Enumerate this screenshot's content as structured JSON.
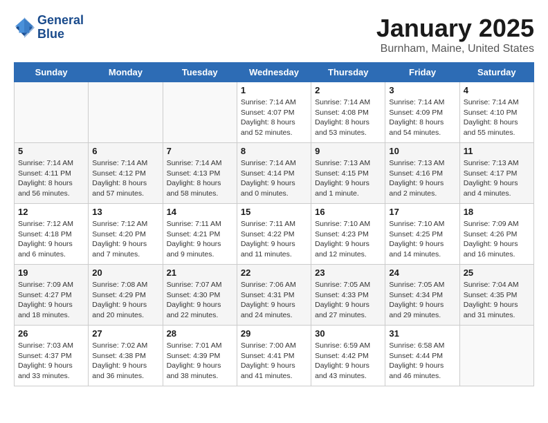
{
  "logo": {
    "line1": "General",
    "line2": "Blue"
  },
  "title": "January 2025",
  "location": "Burnham, Maine, United States",
  "days_of_week": [
    "Sunday",
    "Monday",
    "Tuesday",
    "Wednesday",
    "Thursday",
    "Friday",
    "Saturday"
  ],
  "weeks": [
    [
      {
        "day": "",
        "info": ""
      },
      {
        "day": "",
        "info": ""
      },
      {
        "day": "",
        "info": ""
      },
      {
        "day": "1",
        "info": "Sunrise: 7:14 AM\nSunset: 4:07 PM\nDaylight: 8 hours and 52 minutes."
      },
      {
        "day": "2",
        "info": "Sunrise: 7:14 AM\nSunset: 4:08 PM\nDaylight: 8 hours and 53 minutes."
      },
      {
        "day": "3",
        "info": "Sunrise: 7:14 AM\nSunset: 4:09 PM\nDaylight: 8 hours and 54 minutes."
      },
      {
        "day": "4",
        "info": "Sunrise: 7:14 AM\nSunset: 4:10 PM\nDaylight: 8 hours and 55 minutes."
      }
    ],
    [
      {
        "day": "5",
        "info": "Sunrise: 7:14 AM\nSunset: 4:11 PM\nDaylight: 8 hours and 56 minutes."
      },
      {
        "day": "6",
        "info": "Sunrise: 7:14 AM\nSunset: 4:12 PM\nDaylight: 8 hours and 57 minutes."
      },
      {
        "day": "7",
        "info": "Sunrise: 7:14 AM\nSunset: 4:13 PM\nDaylight: 8 hours and 58 minutes."
      },
      {
        "day": "8",
        "info": "Sunrise: 7:14 AM\nSunset: 4:14 PM\nDaylight: 9 hours and 0 minutes."
      },
      {
        "day": "9",
        "info": "Sunrise: 7:13 AM\nSunset: 4:15 PM\nDaylight: 9 hours and 1 minute."
      },
      {
        "day": "10",
        "info": "Sunrise: 7:13 AM\nSunset: 4:16 PM\nDaylight: 9 hours and 2 minutes."
      },
      {
        "day": "11",
        "info": "Sunrise: 7:13 AM\nSunset: 4:17 PM\nDaylight: 9 hours and 4 minutes."
      }
    ],
    [
      {
        "day": "12",
        "info": "Sunrise: 7:12 AM\nSunset: 4:18 PM\nDaylight: 9 hours and 6 minutes."
      },
      {
        "day": "13",
        "info": "Sunrise: 7:12 AM\nSunset: 4:20 PM\nDaylight: 9 hours and 7 minutes."
      },
      {
        "day": "14",
        "info": "Sunrise: 7:11 AM\nSunset: 4:21 PM\nDaylight: 9 hours and 9 minutes."
      },
      {
        "day": "15",
        "info": "Sunrise: 7:11 AM\nSunset: 4:22 PM\nDaylight: 9 hours and 11 minutes."
      },
      {
        "day": "16",
        "info": "Sunrise: 7:10 AM\nSunset: 4:23 PM\nDaylight: 9 hours and 12 minutes."
      },
      {
        "day": "17",
        "info": "Sunrise: 7:10 AM\nSunset: 4:25 PM\nDaylight: 9 hours and 14 minutes."
      },
      {
        "day": "18",
        "info": "Sunrise: 7:09 AM\nSunset: 4:26 PM\nDaylight: 9 hours and 16 minutes."
      }
    ],
    [
      {
        "day": "19",
        "info": "Sunrise: 7:09 AM\nSunset: 4:27 PM\nDaylight: 9 hours and 18 minutes."
      },
      {
        "day": "20",
        "info": "Sunrise: 7:08 AM\nSunset: 4:29 PM\nDaylight: 9 hours and 20 minutes."
      },
      {
        "day": "21",
        "info": "Sunrise: 7:07 AM\nSunset: 4:30 PM\nDaylight: 9 hours and 22 minutes."
      },
      {
        "day": "22",
        "info": "Sunrise: 7:06 AM\nSunset: 4:31 PM\nDaylight: 9 hours and 24 minutes."
      },
      {
        "day": "23",
        "info": "Sunrise: 7:05 AM\nSunset: 4:33 PM\nDaylight: 9 hours and 27 minutes."
      },
      {
        "day": "24",
        "info": "Sunrise: 7:05 AM\nSunset: 4:34 PM\nDaylight: 9 hours and 29 minutes."
      },
      {
        "day": "25",
        "info": "Sunrise: 7:04 AM\nSunset: 4:35 PM\nDaylight: 9 hours and 31 minutes."
      }
    ],
    [
      {
        "day": "26",
        "info": "Sunrise: 7:03 AM\nSunset: 4:37 PM\nDaylight: 9 hours and 33 minutes."
      },
      {
        "day": "27",
        "info": "Sunrise: 7:02 AM\nSunset: 4:38 PM\nDaylight: 9 hours and 36 minutes."
      },
      {
        "day": "28",
        "info": "Sunrise: 7:01 AM\nSunset: 4:39 PM\nDaylight: 9 hours and 38 minutes."
      },
      {
        "day": "29",
        "info": "Sunrise: 7:00 AM\nSunset: 4:41 PM\nDaylight: 9 hours and 41 minutes."
      },
      {
        "day": "30",
        "info": "Sunrise: 6:59 AM\nSunset: 4:42 PM\nDaylight: 9 hours and 43 minutes."
      },
      {
        "day": "31",
        "info": "Sunrise: 6:58 AM\nSunset: 4:44 PM\nDaylight: 9 hours and 46 minutes."
      },
      {
        "day": "",
        "info": ""
      }
    ]
  ]
}
